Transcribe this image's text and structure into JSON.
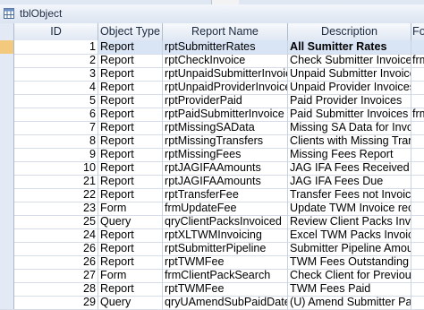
{
  "window": {
    "title": "tblObject"
  },
  "columns": [
    "ID",
    "Object Type",
    "Report Name",
    "Description",
    "Fo"
  ],
  "rows": [
    {
      "id": "1",
      "type": "Report",
      "name": "rptSubmitterRates",
      "desc": "All Sumitter Rates",
      "fo": ""
    },
    {
      "id": "2",
      "type": "Report",
      "name": "rptCheckInvoice",
      "desc": "Check Submitter Invoices",
      "fo": "frm"
    },
    {
      "id": "3",
      "type": "Report",
      "name": "rptUnpaidSubmitterInvoice",
      "desc": "Unpaid Submitter Invoices",
      "fo": ""
    },
    {
      "id": "4",
      "type": "Report",
      "name": "rptUnpaidProviderInvoice",
      "desc": "Unpaid Provider Invoices",
      "fo": ""
    },
    {
      "id": "5",
      "type": "Report",
      "name": "rptProviderPaid",
      "desc": "Paid Provider Invoices",
      "fo": ""
    },
    {
      "id": "6",
      "type": "Report",
      "name": "rptPaidSubmitterInvoice",
      "desc": "Paid Submitter Invoices",
      "fo": "frm"
    },
    {
      "id": "7",
      "type": "Report",
      "name": "rptMissingSAData",
      "desc": "Missing SA Data for Invoicing",
      "fo": ""
    },
    {
      "id": "8",
      "type": "Report",
      "name": "rptMissingTransfers",
      "desc": "Clients with Missing Transfers",
      "fo": ""
    },
    {
      "id": "9",
      "type": "Report",
      "name": "rptMissingFees",
      "desc": "Missing Fees Report",
      "fo": ""
    },
    {
      "id": "10",
      "type": "Report",
      "name": "rptJAGIFAAmounts",
      "desc": "JAG IFA Fees Received",
      "fo": ""
    },
    {
      "id": "21",
      "type": "Report",
      "name": "rptJAGIFAAmounts",
      "desc": "JAG IFA Fees Due",
      "fo": ""
    },
    {
      "id": "22",
      "type": "Report",
      "name": "rptTransferFee",
      "desc": "Transfer Fees not Invoiced",
      "fo": ""
    },
    {
      "id": "23",
      "type": "Form",
      "name": "frmUpdateFee",
      "desc": "Update TWM Invoice records",
      "fo": ""
    },
    {
      "id": "25",
      "type": "Query",
      "name": "qryClientPacksInvoiced",
      "desc": "Review Client Packs Invoiced",
      "fo": ""
    },
    {
      "id": "24",
      "type": "Report",
      "name": "rptXLTWMInvoicing",
      "desc": "Excel TWM Packs Invoicing",
      "fo": ""
    },
    {
      "id": "26",
      "type": "Report",
      "name": "rptSubmitterPipeline",
      "desc": "Submitter Pipeline Amounts In",
      "fo": ""
    },
    {
      "id": "26",
      "type": "Report",
      "name": "rptTWMFee",
      "desc": "TWM Fees Outstanding",
      "fo": ""
    },
    {
      "id": "27",
      "type": "Form",
      "name": "frmClientPackSearch",
      "desc": "Check Client for Previous Pack",
      "fo": ""
    },
    {
      "id": "28",
      "type": "Report",
      "name": "rptTWMFee",
      "desc": "TWM Fees Paid",
      "fo": ""
    },
    {
      "id": "29",
      "type": "Query",
      "name": "qryUAmendSubPaidDate",
      "desc": "(U) Amend Submitter Paid Date",
      "fo": ""
    }
  ],
  "colors": {
    "header": "#e0e8f3",
    "selector": "#e3eaf5",
    "current_row": "#d9e4f4"
  }
}
